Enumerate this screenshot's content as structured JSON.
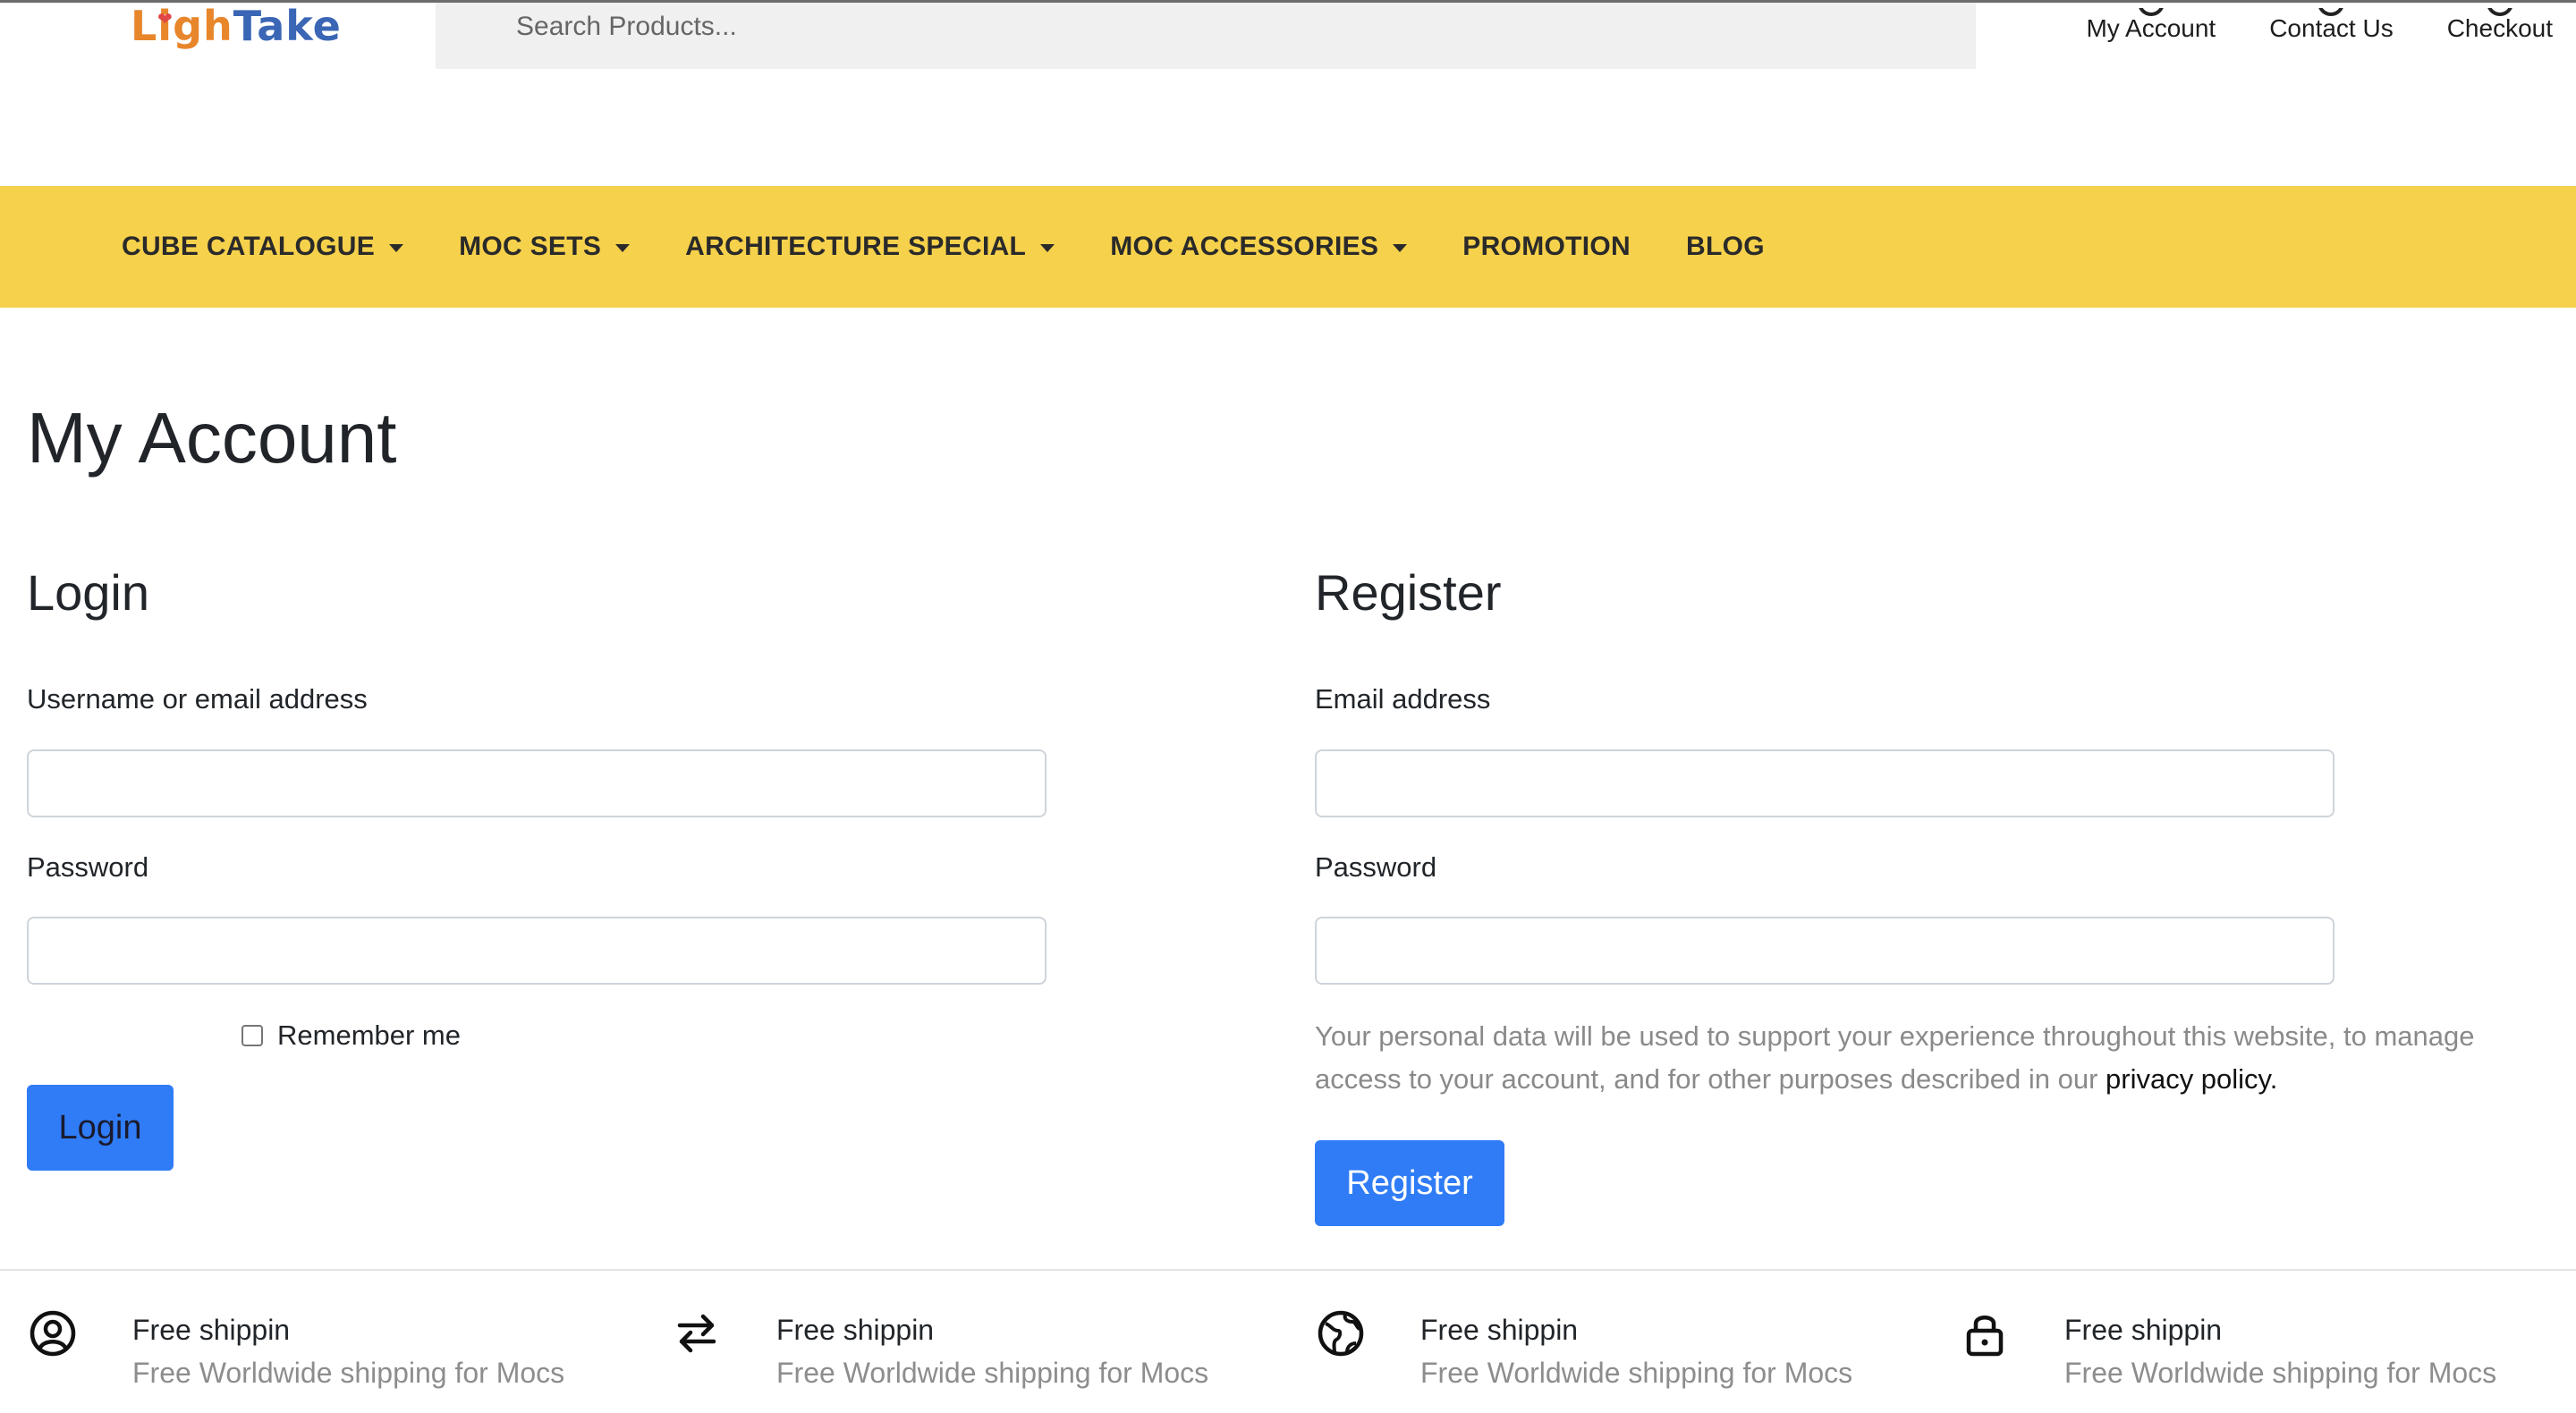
{
  "header": {
    "logo_text_1": "Ligh",
    "logo_text_2": "Take",
    "search_placeholder": "Search Products...",
    "top_links": [
      "My Account",
      "Contact Us",
      "Checkout"
    ]
  },
  "nav": {
    "items": [
      {
        "label": "CUBE CATALOGUE",
        "dropdown": true
      },
      {
        "label": "MOC SETS",
        "dropdown": true
      },
      {
        "label": "ARCHITECTURE SPECIAL",
        "dropdown": true
      },
      {
        "label": "MOC ACCESSORIES",
        "dropdown": true
      },
      {
        "label": "PROMOTION",
        "dropdown": false
      },
      {
        "label": "BLOG",
        "dropdown": false
      }
    ]
  },
  "page": {
    "title": "My Account"
  },
  "login": {
    "title": "Login",
    "username_label": "Username or email address",
    "username_value": "",
    "password_label": "Password",
    "password_value": "",
    "remember_label": "Remember me",
    "remember_checked": false,
    "button_label": "Login"
  },
  "register": {
    "title": "Register",
    "email_label": "Email address",
    "email_value": "",
    "password_label": "Password",
    "password_value": "",
    "privacy_text": "Your personal data will be used to support your experience throughout this website, to manage access to your account, and for other purposes described in our ",
    "privacy_link": "privacy policy",
    "privacy_end": ".",
    "button_label": "Register"
  },
  "features": [
    {
      "icon": "user-circle-icon",
      "title": "Free shippin",
      "subtitle": "Free Worldwide shipping for Mocs"
    },
    {
      "icon": "arrows-exchange-icon",
      "title": "Free shippin",
      "subtitle": "Free Worldwide shipping for Mocs"
    },
    {
      "icon": "globe-icon",
      "title": "Free shippin",
      "subtitle": "Free Worldwide shipping for Mocs"
    },
    {
      "icon": "lock-icon",
      "title": "Free shippin",
      "subtitle": "Free Worldwide shipping for Mocs"
    }
  ],
  "colors": {
    "nav_bg": "#f6d14b",
    "button_bg": "#2f7cf6",
    "search_bg": "#f0f0f0"
  }
}
